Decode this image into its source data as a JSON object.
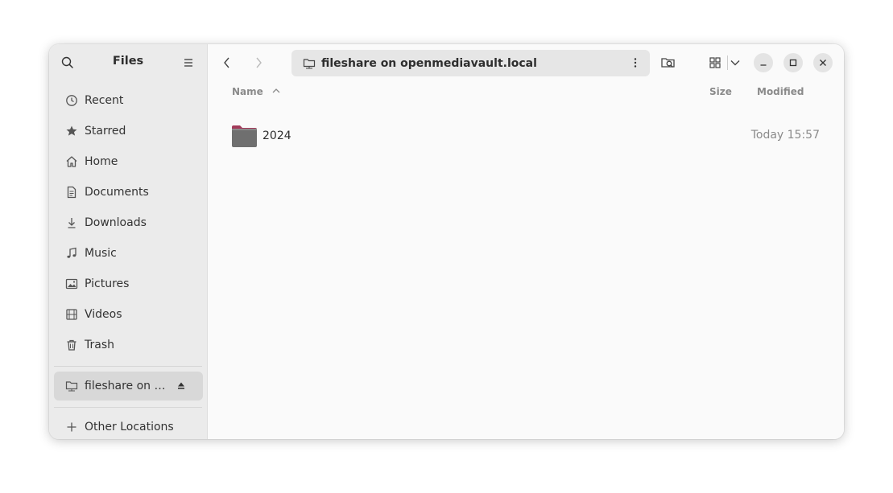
{
  "sidebar": {
    "title": "Files",
    "items": [
      {
        "label": "Recent",
        "icon": "clock-icon"
      },
      {
        "label": "Starred",
        "icon": "star-icon"
      },
      {
        "label": "Home",
        "icon": "home-icon"
      },
      {
        "label": "Documents",
        "icon": "document-icon"
      },
      {
        "label": "Downloads",
        "icon": "download-icon"
      },
      {
        "label": "Music",
        "icon": "music-icon"
      },
      {
        "label": "Pictures",
        "icon": "picture-icon"
      },
      {
        "label": "Videos",
        "icon": "video-icon"
      },
      {
        "label": "Trash",
        "icon": "trash-icon"
      }
    ],
    "mount": {
      "label": "fileshare on …",
      "icon": "network-folder-icon"
    },
    "other_locations": "Other Locations"
  },
  "header": {
    "path": "fileshare on openmediavault.local"
  },
  "columns": {
    "name": "Name",
    "size": "Size",
    "modified": "Modified"
  },
  "files": [
    {
      "name": "2024",
      "size": "",
      "modified": "Today 15:57",
      "type": "folder"
    }
  ],
  "colors": {
    "sidebar_bg": "#ebebeb",
    "main_bg": "#fafafa",
    "selected_bg": "#d8d8d8",
    "folder_tab": "#a33a5a",
    "folder_body": "#6f6f6f"
  }
}
